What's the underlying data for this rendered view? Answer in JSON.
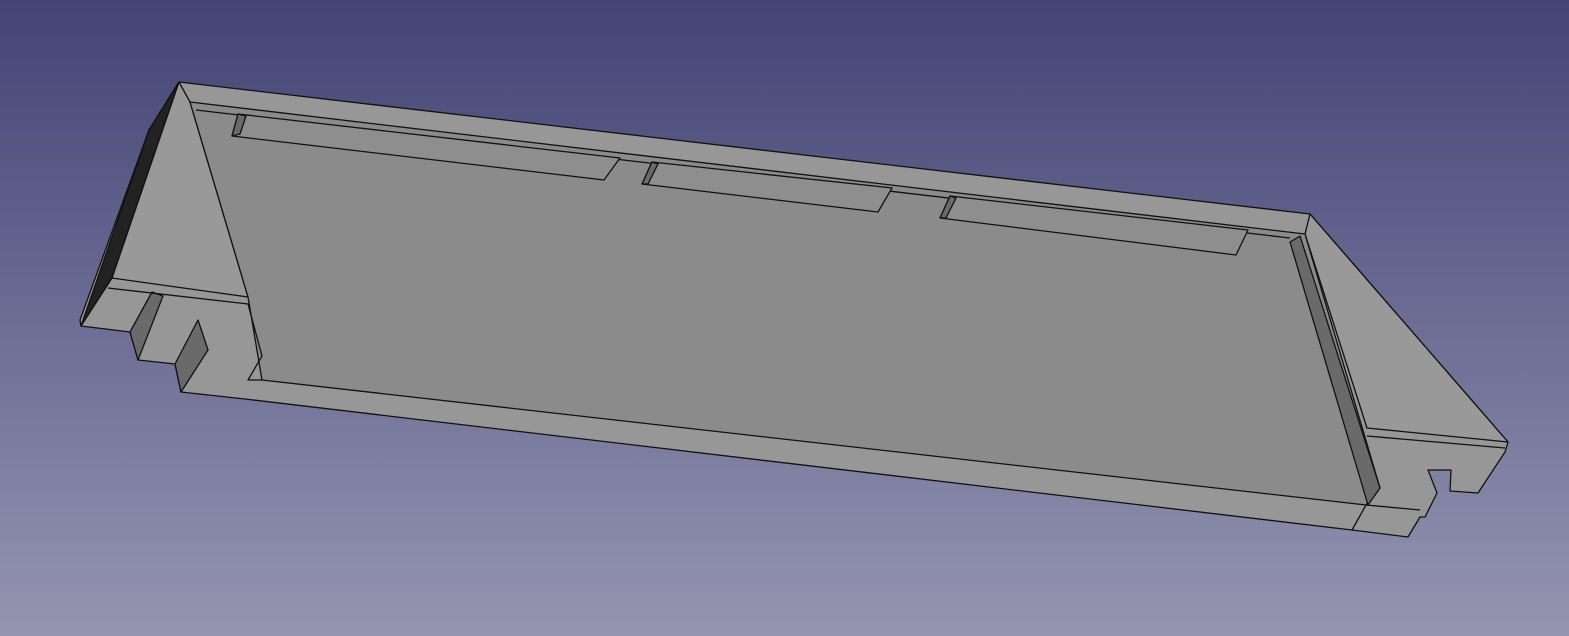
{
  "viewport": {
    "background_top": "#434474",
    "background_bottom": "#9595b1",
    "model_color": "#8c8c8c",
    "model_light_color": "#999999",
    "model_dark_color": "#222222",
    "edge_color": "#111111"
  }
}
